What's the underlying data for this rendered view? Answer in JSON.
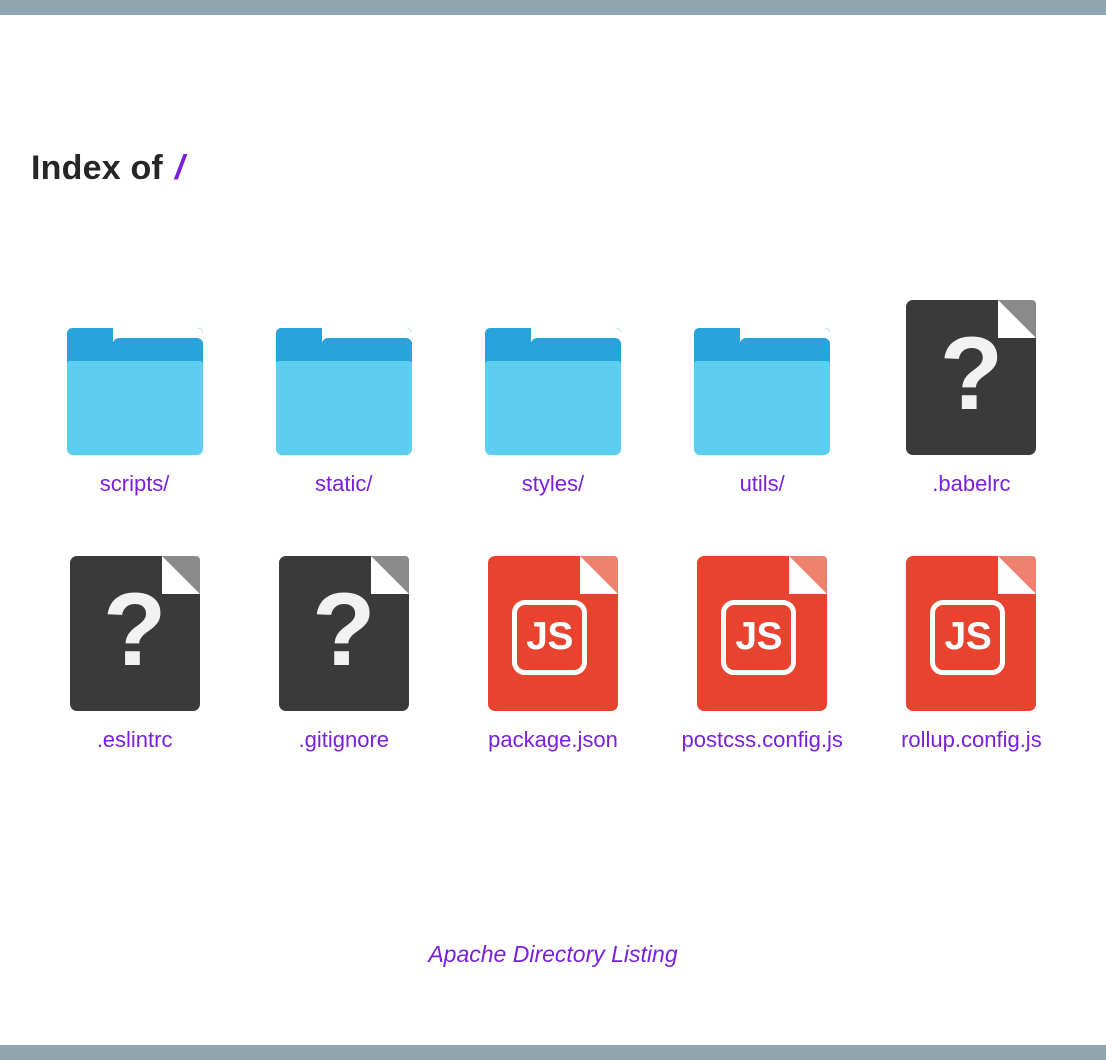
{
  "theme": {
    "bar_color": "#8ea5ae",
    "background": "#ffffff",
    "link_color": "#7a1fe0",
    "title_color": "#262626",
    "folder_back": "#29a3dc",
    "folder_front": "#5dcdf0",
    "file_unknown": "#3a3a3a",
    "file_unknown_fold": "#8a8a8a",
    "file_js": "#e8432f",
    "file_js_fold": "#f0816f"
  },
  "header": {
    "title_prefix": "Index of",
    "path": "/"
  },
  "entries": [
    {
      "label": "scripts/",
      "kind": "folder",
      "icon": "folder-icon"
    },
    {
      "label": "static/",
      "kind": "folder",
      "icon": "folder-icon"
    },
    {
      "label": "styles/",
      "kind": "folder",
      "icon": "folder-icon"
    },
    {
      "label": "utils/",
      "kind": "folder",
      "icon": "folder-icon"
    },
    {
      "label": ".babelrc",
      "kind": "file-unknown",
      "icon": "unknown-file-icon",
      "glyph": "?"
    },
    {
      "label": ".eslintrc",
      "kind": "file-unknown",
      "icon": "unknown-file-icon",
      "glyph": "?"
    },
    {
      "label": ".gitignore",
      "kind": "file-unknown",
      "icon": "unknown-file-icon",
      "glyph": "?"
    },
    {
      "label": "package.json",
      "kind": "file-js",
      "icon": "javascript-file-icon",
      "glyph": "JS"
    },
    {
      "label": "postcss.config.js",
      "kind": "file-js",
      "icon": "javascript-file-icon",
      "glyph": "JS"
    },
    {
      "label": "rollup.config.js",
      "kind": "file-js",
      "icon": "javascript-file-icon",
      "glyph": "JS"
    }
  ],
  "footer": {
    "note": "Apache Directory Listing"
  }
}
